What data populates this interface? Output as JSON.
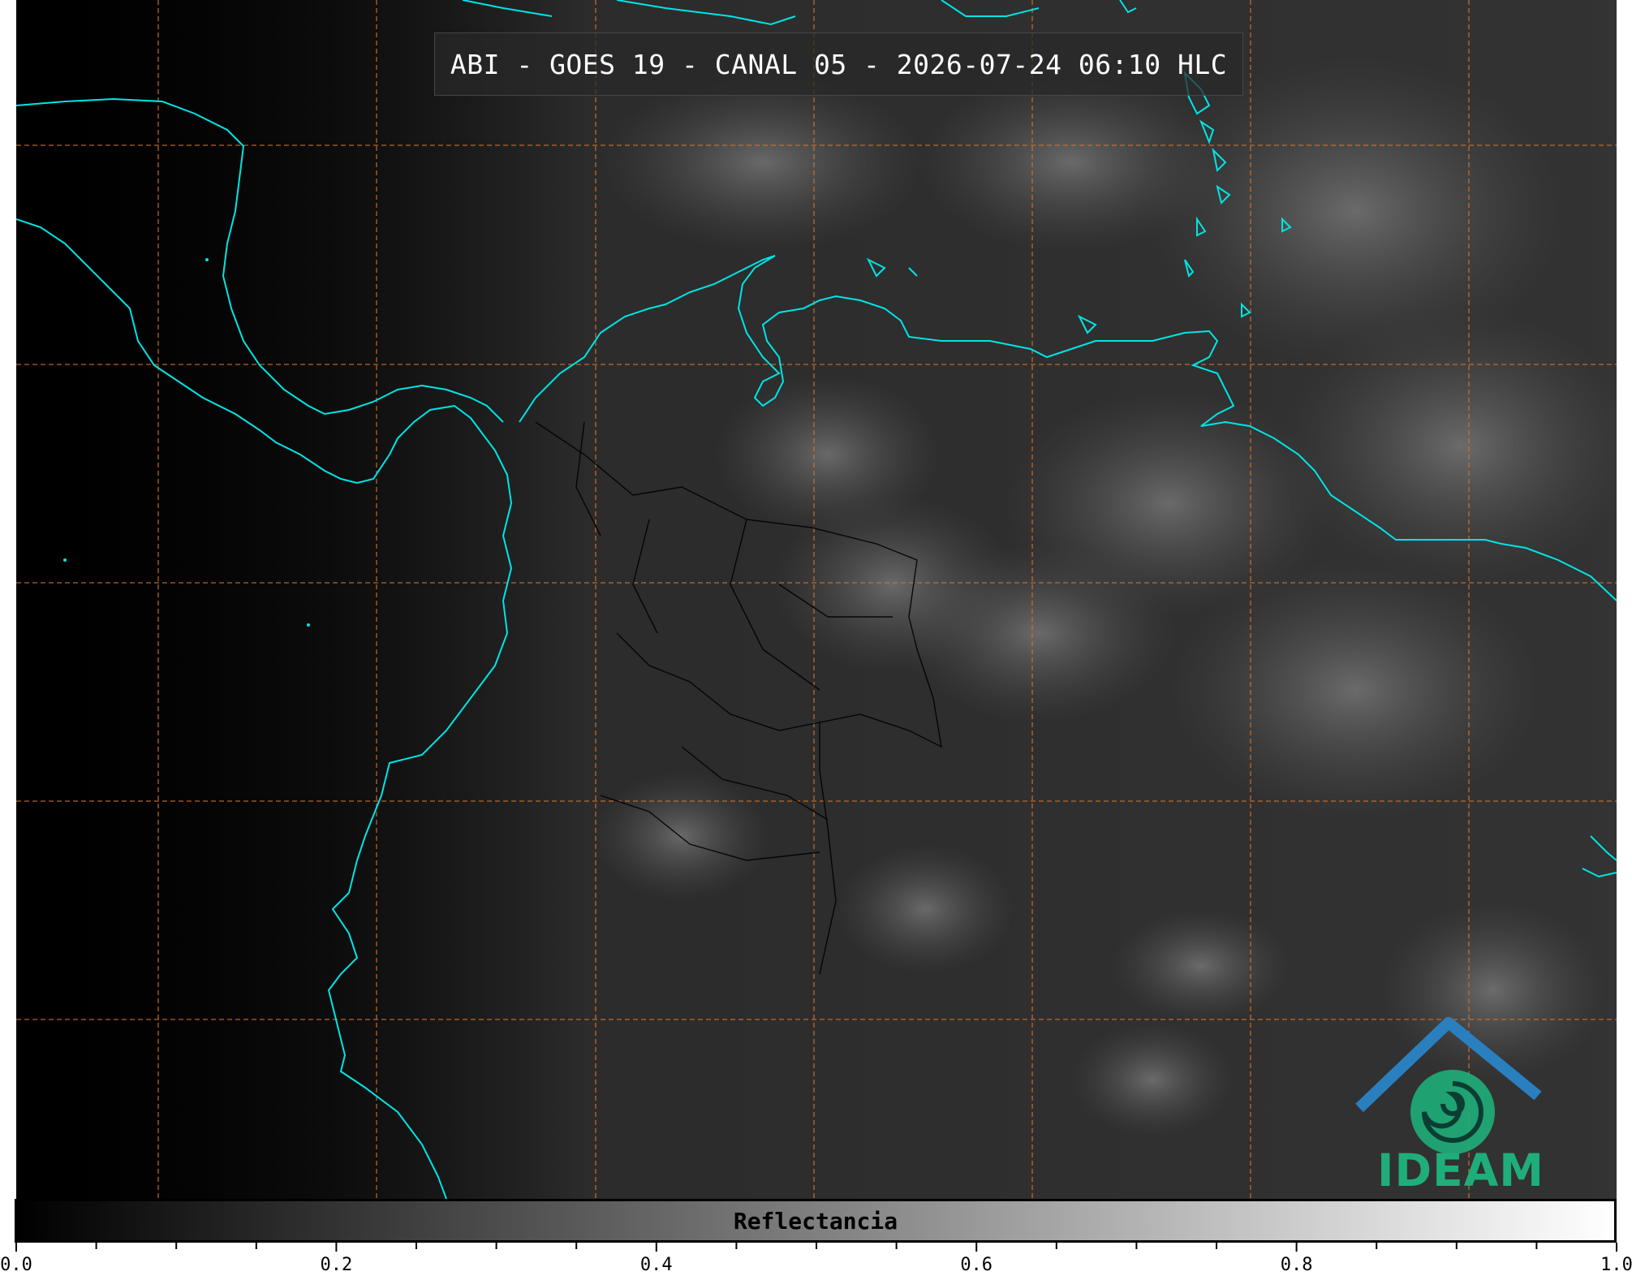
{
  "title": "ABI - GOES 19 - CANAL 05 - 2026-07-24 06:10 HLC",
  "colorbar": {
    "label": "Reflectancia",
    "range": [
      0.0,
      1.0
    ],
    "tick_labels": [
      "0.0",
      "0.2",
      "0.4",
      "0.6",
      "0.8",
      "1.0"
    ],
    "colors": {
      "low": "#000000",
      "high": "#ffffff"
    }
  },
  "logo": {
    "text": "IDEAM",
    "colors": {
      "primary": "#1fae7a",
      "secondary": "#2a7fbf"
    }
  },
  "map": {
    "coastline_color": "#00e5e5",
    "gridline_color": "#d9732a",
    "border_color": "#000000",
    "gridlines": "dashed"
  }
}
